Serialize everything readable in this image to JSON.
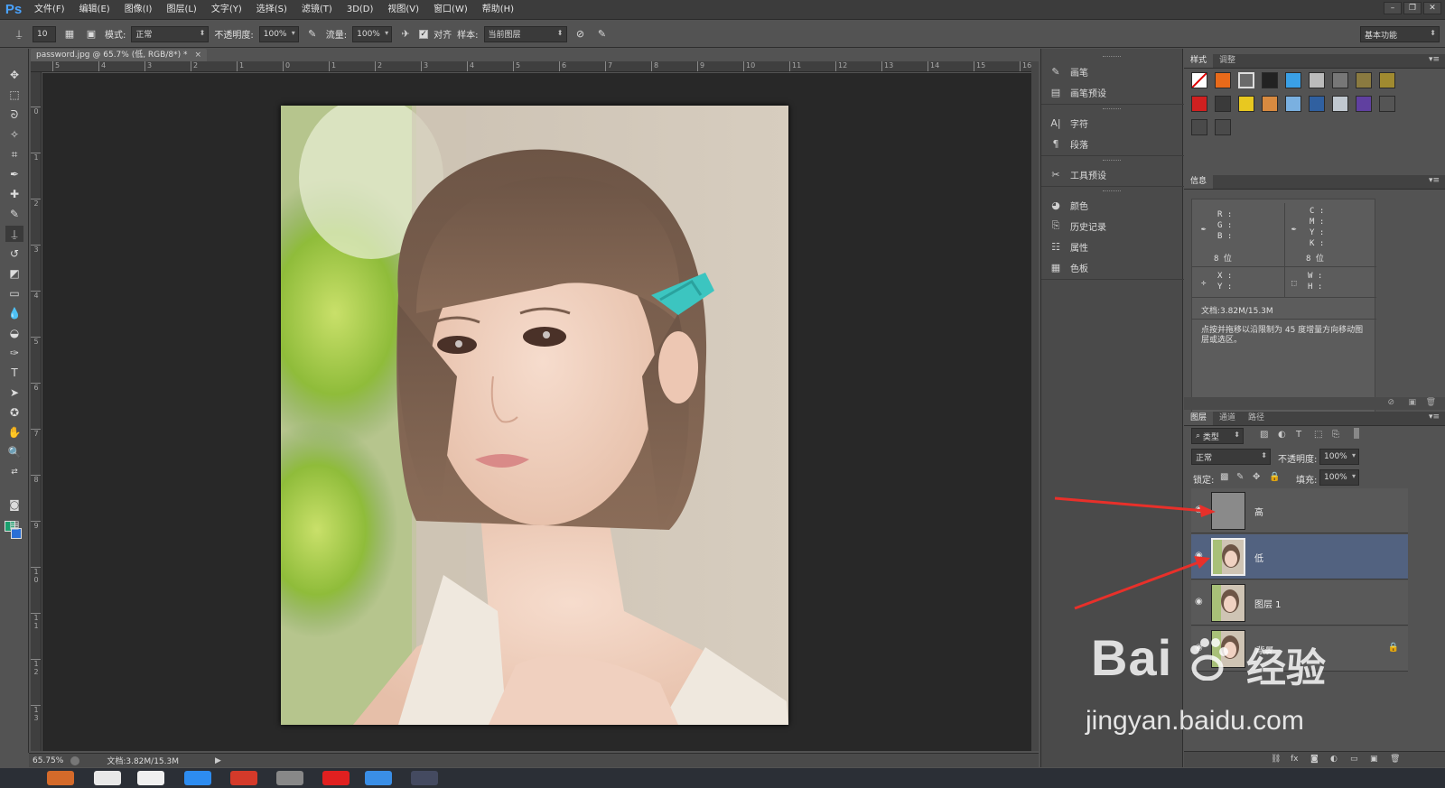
{
  "app": {
    "logo": "Ps"
  },
  "menu": [
    "文件(F)",
    "编辑(E)",
    "图像(I)",
    "图层(L)",
    "文字(Y)",
    "选择(S)",
    "滤镜(T)",
    "3D(D)",
    "视图(V)",
    "窗口(W)",
    "帮助(H)"
  ],
  "window_controls": [
    "–",
    "❐",
    "✕"
  ],
  "options": {
    "brush_size": "10",
    "mode_label": "模式:",
    "mode_value": "正常",
    "opacity_label": "不透明度:",
    "opacity_value": "100%",
    "flow_label": "流量:",
    "flow_value": "100%",
    "align_label": "对齐",
    "sample_label": "样本:",
    "sample_value": "当前图层",
    "workspace": "基本功能"
  },
  "document": {
    "tab_title": "password.jpg @ 65.7% (低, RGB/8*) *",
    "close": "×"
  },
  "ruler_h": [
    "5",
    "4",
    "3",
    "2",
    "1",
    "0",
    "1",
    "2",
    "3",
    "4",
    "5",
    "6",
    "7",
    "8",
    "9",
    "10",
    "11",
    "12",
    "13",
    "14",
    "15",
    "16"
  ],
  "ruler_v": [
    "0",
    "1",
    "2",
    "3",
    "4",
    "5",
    "6",
    "7",
    "8",
    "9",
    "1 0",
    "1 1",
    "1 2",
    "1 3"
  ],
  "status": {
    "zoom": "65.75%",
    "doc": "文档:3.82M/15.3M"
  },
  "dock": {
    "brush": "画笔",
    "brush_presets": "画笔预设",
    "character": "字符",
    "paragraph": "段落",
    "tool_presets": "工具预设",
    "color": "颜色",
    "history": "历史记录",
    "properties": "属性",
    "swatches": "色板"
  },
  "styles_panel": {
    "tabs": [
      "样式",
      "调整"
    ]
  },
  "info_panel": {
    "tab": "信息",
    "rgb": [
      "R :",
      "G :",
      "B :"
    ],
    "cmyk": [
      "C :",
      "M :",
      "Y :",
      "K :"
    ],
    "bits_left": "8 位",
    "bits_right": "8 位",
    "xy": [
      "X :",
      "Y :"
    ],
    "wh": [
      "W :",
      "H :"
    ],
    "doc": "文档:3.82M/15.3M",
    "hint": "点按并拖移以沿限制为 45 度增量方向移动图层或选区。"
  },
  "layers_panel": {
    "tabs": [
      "图层",
      "通道",
      "路径"
    ],
    "filter": "类型",
    "blend": "正常",
    "opacity_label": "不透明度:",
    "opacity_value": "100%",
    "lock_label": "锁定:",
    "fill_label": "填充:",
    "fill_value": "100%",
    "layers": [
      {
        "name": "高",
        "selected": false
      },
      {
        "name": "低",
        "selected": true
      },
      {
        "name": "图层 1",
        "selected": false
      },
      {
        "name": "背景",
        "selected": false,
        "locked": true
      }
    ]
  },
  "watermark": {
    "brand": "Bai",
    "brand2": "经验",
    "url": "jingyan.baidu.com"
  },
  "colors": {
    "foreground": "#1aa06e",
    "background": "#2a6fd6",
    "selection": "#526280",
    "arrow": "#e8302a"
  }
}
